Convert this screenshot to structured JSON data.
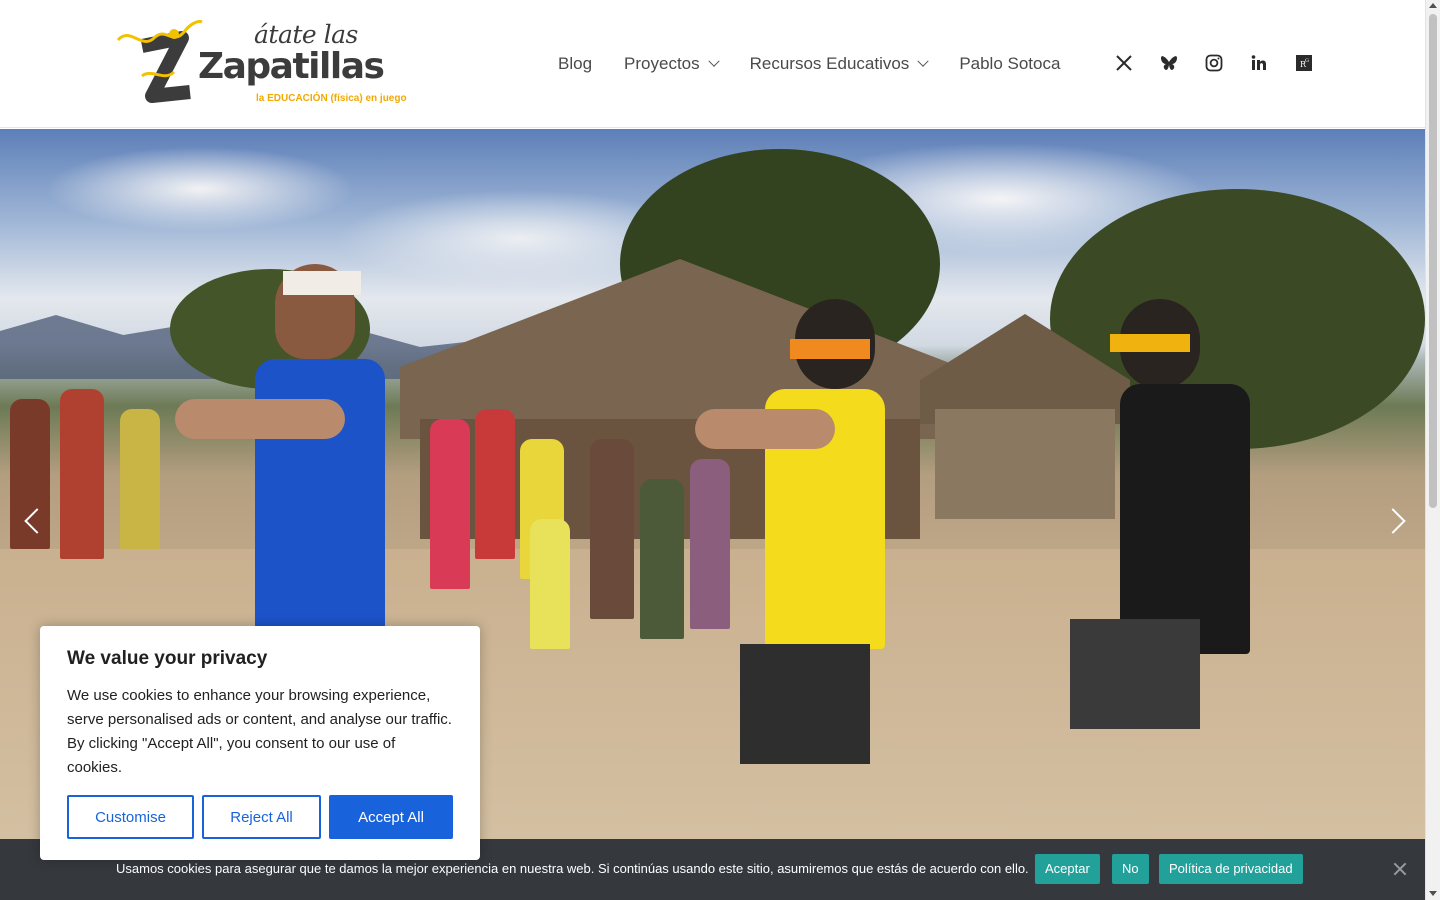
{
  "brand": {
    "line1": "átate las",
    "line2": "Zapatillas",
    "tagline": "la EDUCACIÓN (física) en juego",
    "accent_color": "#f2a900",
    "dark_color": "#3c3c3c"
  },
  "nav": {
    "items": [
      {
        "label": "Blog",
        "has_dropdown": false
      },
      {
        "label": "Proyectos",
        "has_dropdown": true
      },
      {
        "label": "Recursos Educativos",
        "has_dropdown": true
      },
      {
        "label": "Pablo Sotoca",
        "has_dropdown": false
      }
    ]
  },
  "social": [
    "x-icon",
    "bluesky-icon",
    "instagram-icon",
    "linkedin-icon",
    "researchgate-icon"
  ],
  "hero": {
    "prev_icon": "chevron-left-icon",
    "next_icon": "chevron-right-icon"
  },
  "privacy_modal": {
    "title": "We value your privacy",
    "body": "We use cookies to enhance your browsing experience, serve personalised ads or content, and analyse our traffic. By clicking \"Accept All\", you consent to our use of cookies.",
    "customise": "Customise",
    "reject": "Reject All",
    "accept": "Accept All",
    "primary_color": "#1863dc"
  },
  "cookie_bar": {
    "message": "Usamos cookies para asegurar que te damos la mejor experiencia en nuestra web. Si continúas usando este sitio, asumiremos que estás de acuerdo con ello.",
    "accept": "Aceptar",
    "no": "No",
    "privacy": "Política de privacidad",
    "button_color": "#21a19a"
  }
}
